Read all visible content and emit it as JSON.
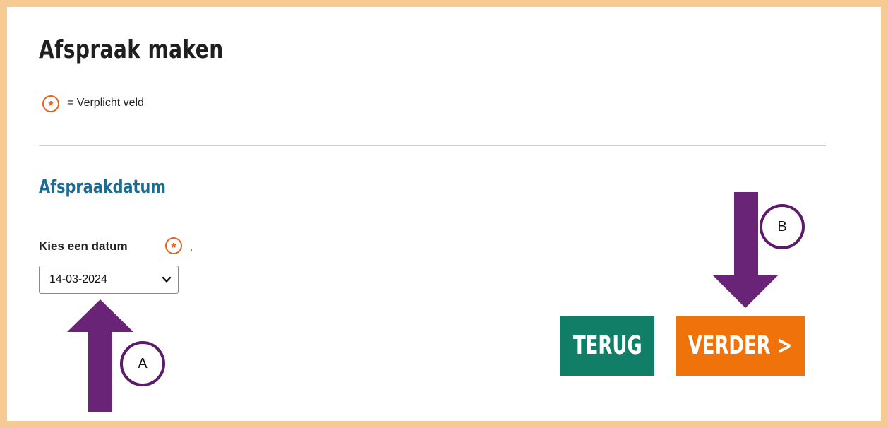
{
  "page": {
    "title": "Afspraak maken",
    "required_legend": {
      "symbol": "*",
      "text": "= Verplicht veld"
    }
  },
  "section": {
    "title": "Afspraakdatum"
  },
  "date_field": {
    "label": "Kies een datum",
    "required_symbol": "*",
    "selected_value": "14-03-2024"
  },
  "buttons": {
    "back_label": "TERUG",
    "next_label": "VERDER >"
  },
  "annotations": {
    "a_label": "A",
    "b_label": "B"
  },
  "colors": {
    "frame": "#f5cb93",
    "required": "#e8611a",
    "section_title": "#1b6b93",
    "back_button": "#117f68",
    "next_button": "#ef720a",
    "annotation": "#6a2477"
  },
  "icons": {
    "required": "required-asterisk-icon",
    "select": "chevron-down-icon",
    "annotation_arrows": [
      "up-arrow-icon",
      "down-arrow-icon"
    ]
  }
}
